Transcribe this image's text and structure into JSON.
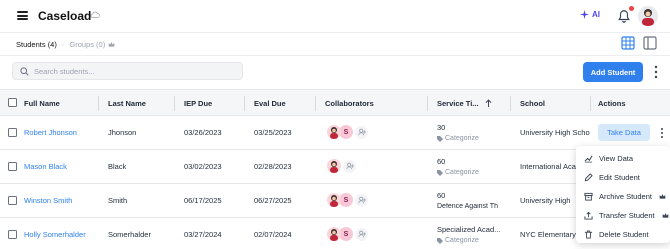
{
  "header": {
    "title": "Caseload",
    "ai_label": "AI"
  },
  "subtabs": {
    "students": "Students (4)",
    "separator": "·",
    "groups": "Groups (0)"
  },
  "search": {
    "placeholder": "Search students..."
  },
  "toolbar": {
    "add_student": "Add Student"
  },
  "table": {
    "columns": [
      "Full Name",
      "Last Name",
      "IEP Due",
      "Eval Due",
      "Collaborators",
      "Service Ti...",
      "School",
      "Actions"
    ],
    "rows": [
      {
        "full_name": "Robert Jhonson",
        "last_name": "Jhonson",
        "iep_due": "03/26/2023",
        "eval_due": "03/25/2023",
        "service": "30",
        "category": "Categorize",
        "school": "University High Scho",
        "collab_letter": "S"
      },
      {
        "full_name": "Mason Black",
        "last_name": "Black",
        "iep_due": "03/02/2023",
        "eval_due": "02/28/2023",
        "service": "60",
        "category": "Categorize",
        "school": "International Aca",
        "collab_letter": ""
      },
      {
        "full_name": "Winston Smith",
        "last_name": "Smith",
        "iep_due": "06/17/2025",
        "eval_due": "06/27/2025",
        "service": "60",
        "category": "Defence Against Th",
        "school": "University High",
        "collab_letter": "S"
      },
      {
        "full_name": "Holly Somerhalder",
        "last_name": "Somerhalder",
        "iep_due": "03/27/2024",
        "eval_due": "02/07/2024",
        "service": "Specialized Acad...",
        "category": "Categorize",
        "school": "NYC Elementary",
        "collab_letter": "S"
      }
    ],
    "take_data": "Take Data"
  },
  "menu": {
    "items": [
      {
        "label": "View Data",
        "icon": "chart-icon"
      },
      {
        "label": "Edit Student",
        "icon": "pencil-icon"
      },
      {
        "label": "Archive Student",
        "icon": "archive-icon"
      },
      {
        "label": "Transfer Student",
        "icon": "transfer-icon"
      },
      {
        "label": "Delete Student",
        "icon": "trash-icon"
      }
    ]
  },
  "colors": {
    "accent": "#2f80ed",
    "ai": "#4f46e5",
    "notification": "#ef4444",
    "collab_pink": "#f9c8d6"
  }
}
